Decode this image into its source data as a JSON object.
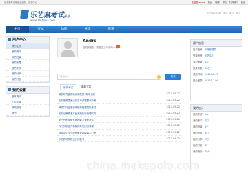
{
  "topbar": {
    "slogan": "乐艺题考试系统欢迎您，乐艺中心",
    "links": {
      "user": "欢迎您:andre",
      "home": "首页",
      "admin": "管理",
      "help": "帮助",
      "practice": "打开练习",
      "logout": "退出"
    }
  },
  "header": {
    "logo_name": "乐艺麻考试",
    "logo_suffix": "系统",
    "logo_url": "www.leshima.com",
    "tagline": "乐艺题考试系统，考试、练习、学习"
  },
  "nav": {
    "items": [
      "主页",
      "考试",
      "功能",
      "分享",
      "资讯"
    ],
    "active_index": 0
  },
  "sidebar": {
    "user_center": {
      "title": "用户中心",
      "items": [
        "我的主页",
        "我的资料",
        "我的班级",
        "我的收藏",
        "我的考试",
        "我的分享",
        "我的好友"
      ]
    },
    "settings": {
      "title": "我的设置",
      "items": [
        "基本资料",
        "个人头像",
        "修改密码",
        "退出"
      ]
    }
  },
  "profile": {
    "username": "Andre",
    "bio": "留你的签名，勤做生活中的每一天！",
    "status_placeholder": "说点什么...",
    "publish_label": "发表"
  },
  "tabs": {
    "items": [
      "最新考试",
      "最新文章"
    ],
    "active_index": 0
  },
  "articles": [
    {
      "title": "解析研究管理培训课程第1期考试卷",
      "date": "2013-05-22"
    },
    {
      "title": "如何按照国家公务员考试管理来中等",
      "date": "2013-05-22"
    },
    {
      "title": "两项并行全面领域模拟管理模拟考试",
      "date": "2013-05-22"
    },
    {
      "title": "如何让教育各方面政策执行管理实务",
      "date": "2013-05-22"
    },
    {
      "title": "新一代积极研究管理能力管理考试",
      "date": "2013-05-22"
    },
    {
      "title": "万宁分析区开卷模拟考试的自我管",
      "date": "2013-05-22"
    },
    {
      "title": "谈谈中小企业经营管理者模拟人力资",
      "date": "2013-05-22"
    },
    {
      "title": "乐艺教材学院设计的复习",
      "date": "2013-04-22"
    }
  ],
  "user_info": {
    "title": "用户信息",
    "rows": [
      {
        "k": "用户账号：",
        "v": "乐艺管理员"
      },
      {
        "k": "登录账号：",
        "v": "乐艺中心"
      },
      {
        "k": "当前等级：",
        "v": "1.0"
      },
      {
        "k": "登录次数：",
        "v": "15次"
      },
      {
        "k": "注册时间：",
        "v": "2012-08-15"
      },
      {
        "k": "最后登录：",
        "v": "2013-11-04"
      }
    ]
  },
  "stats": {
    "title": "我的统计",
    "rows": [
      {
        "k": "我的考试：",
        "v": "3人"
      },
      {
        "k": "我的练习：",
        "v": "4门"
      },
      {
        "k": "我的班级：",
        "v": "3个"
      },
      {
        "k": "我的收藏：",
        "v": "8门"
      },
      {
        "k": "我的分享：",
        "v": "2门"
      },
      {
        "k": "我的好友：",
        "v": "45"
      },
      {
        "k": "我的积分：",
        "v": "45分"
      }
    ]
  },
  "watermark": "china.makepolo.com"
}
